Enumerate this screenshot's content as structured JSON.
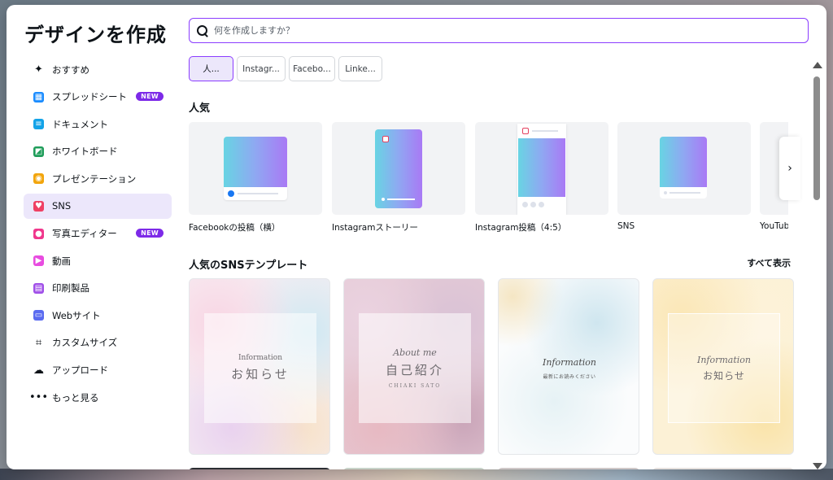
{
  "modal": {
    "title": "デザインを作成"
  },
  "search": {
    "placeholder": "何を作成しますか？"
  },
  "sidebar": {
    "items": [
      {
        "label": "おすすめ",
        "icon": "sparkle-icon",
        "color": "#0e1318"
      },
      {
        "label": "スプレッドシート",
        "icon": "spreadsheet-icon",
        "color": "#1a8cff",
        "badge": "NEW"
      },
      {
        "label": "ドキュメント",
        "icon": "document-icon",
        "color": "#13a3e8"
      },
      {
        "label": "ホワイトボード",
        "icon": "whiteboard-icon",
        "color": "#1f9d5a"
      },
      {
        "label": "プレゼンテーション",
        "icon": "presentation-icon",
        "color": "#f2a50c"
      },
      {
        "label": "SNS",
        "icon": "heart-icon",
        "color": "#ef4064",
        "active": true
      },
      {
        "label": "写真エディター",
        "icon": "camera-icon",
        "color": "#f0378c",
        "badge": "NEW"
      },
      {
        "label": "動画",
        "icon": "video-icon",
        "color": "#e84ce0"
      },
      {
        "label": "印刷製品",
        "icon": "printer-icon",
        "color": "#a04fe8"
      },
      {
        "label": "Webサイト",
        "icon": "website-icon",
        "color": "#5a6bf0"
      },
      {
        "label": "カスタムサイズ",
        "icon": "crop-icon",
        "color": "#0e1318"
      },
      {
        "label": "アップロード",
        "icon": "cloud-upload-icon",
        "color": "#0e1318"
      },
      {
        "label": "もっと見る",
        "icon": "more-dots-icon",
        "color": "#0e1318"
      }
    ]
  },
  "chips": [
    {
      "label": "人...",
      "active": true
    },
    {
      "label": "Instagr..."
    },
    {
      "label": "Facebo..."
    },
    {
      "label": "Linke..."
    }
  ],
  "popular": {
    "title": "人気",
    "cards": [
      {
        "label": "Facebookの投稿（横）"
      },
      {
        "label": "Instagramストーリー"
      },
      {
        "label": "Instagram投稿（4:5）"
      },
      {
        "label": "SNS"
      },
      {
        "label": "YouTub"
      }
    ]
  },
  "templates": {
    "title": "人気のSNSテンプレート",
    "see_all": "すべて表示",
    "items": [
      {
        "script": "Information",
        "main": "お知らせ",
        "small": ""
      },
      {
        "script": "About me",
        "main": "自己紹介",
        "small": "CHIAKI SATO"
      },
      {
        "script": "Information",
        "main": "",
        "small": "最新にお読みください"
      },
      {
        "script": "Information",
        "main": "お知らせ",
        "small": ""
      }
    ]
  },
  "colors": {
    "accent": "#8b3dff",
    "active_bg": "#ece7fb",
    "badge": "#7d2ae8"
  }
}
